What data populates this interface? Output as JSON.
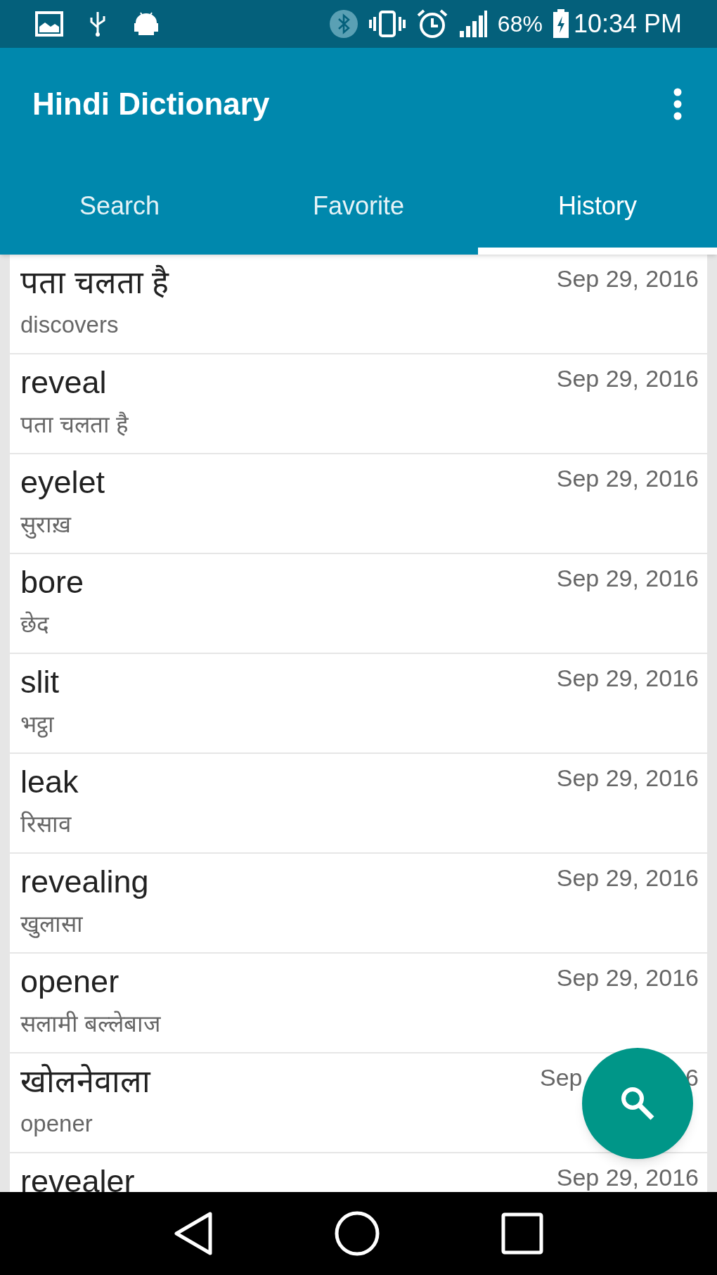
{
  "status_bar": {
    "battery": "68%",
    "time": "10:34 PM"
  },
  "app_bar": {
    "title": "Hindi Dictionary"
  },
  "tabs": [
    {
      "label": "Search",
      "selected": false
    },
    {
      "label": "Favorite",
      "selected": false
    },
    {
      "label": "History",
      "selected": true
    }
  ],
  "history": [
    {
      "word": "पता चलता है",
      "meaning": "discovers",
      "date": "Sep 29, 2016"
    },
    {
      "word": "reveal",
      "meaning": "पता चलता है",
      "date": "Sep 29, 2016"
    },
    {
      "word": "eyelet",
      "meaning": "सुराख़",
      "date": "Sep 29, 2016"
    },
    {
      "word": "bore",
      "meaning": "छेद",
      "date": "Sep 29, 2016"
    },
    {
      "word": "slit",
      "meaning": "भट्ठा",
      "date": "Sep 29, 2016"
    },
    {
      "word": "leak",
      "meaning": "रिसाव",
      "date": "Sep 29, 2016"
    },
    {
      "word": "revealing",
      "meaning": "खुलासा",
      "date": "Sep 29, 2016"
    },
    {
      "word": "opener",
      "meaning": "सलामी बल्लेबाज",
      "date": "Sep 29, 2016"
    },
    {
      "word": "खोलनेवाला",
      "meaning": "opener",
      "date": "Sep",
      "date_tail": "6"
    },
    {
      "word": "revealer",
      "date": "Sep 29, 2016"
    }
  ]
}
